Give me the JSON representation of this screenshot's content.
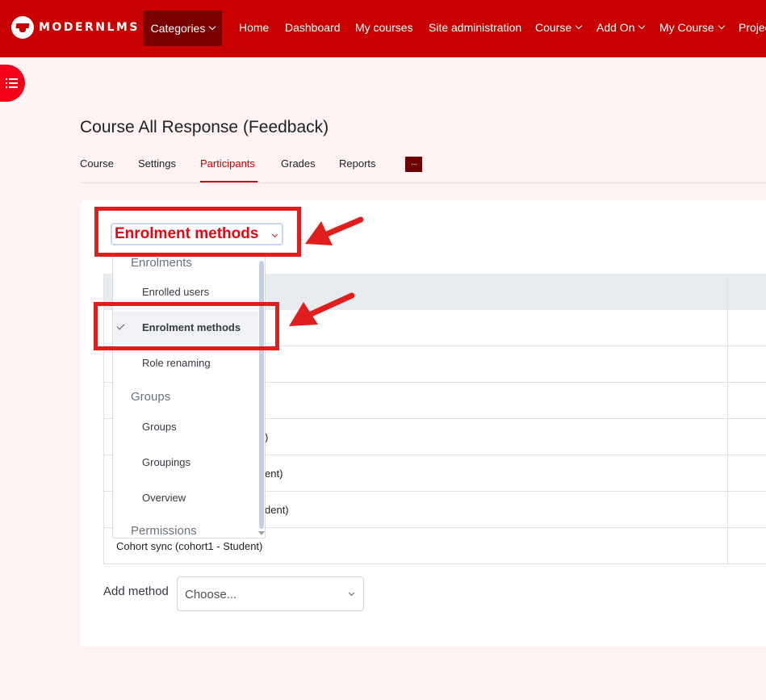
{
  "navbar": {
    "logo_text": "MODERNLMS",
    "categories_label": "Categories",
    "items": [
      "Home",
      "Dashboard",
      "My courses",
      "Site administration",
      "Course",
      "Add On",
      "My Course",
      "Projec"
    ]
  },
  "page": {
    "title": "Course All Response (Feedback)"
  },
  "tabs": [
    "Course",
    "Settings",
    "Participants",
    "Grades",
    "Reports"
  ],
  "tabs_more": "···",
  "selector": {
    "selected": "Enrolment methods"
  },
  "dropdown": {
    "groups": [
      {
        "label": "Enrolments",
        "items": [
          "Enrolled users",
          "Enrolment methods",
          "Role renaming"
        ]
      },
      {
        "label": "Groups",
        "items": [
          "Groups",
          "Groupings",
          "Overview"
        ]
      },
      {
        "label": "Permissions",
        "items": []
      }
    ]
  },
  "table": {
    "rows_partial": [
      ")",
      "ent)",
      "dent)"
    ],
    "last_row": "Cohort sync (cohort1 - Student)"
  },
  "add_method": {
    "label": "Add method",
    "value": "Choose..."
  },
  "colors": {
    "brand_red": "#c80000",
    "dark_red": "#7a0000",
    "highlight": "#e01e1e"
  }
}
